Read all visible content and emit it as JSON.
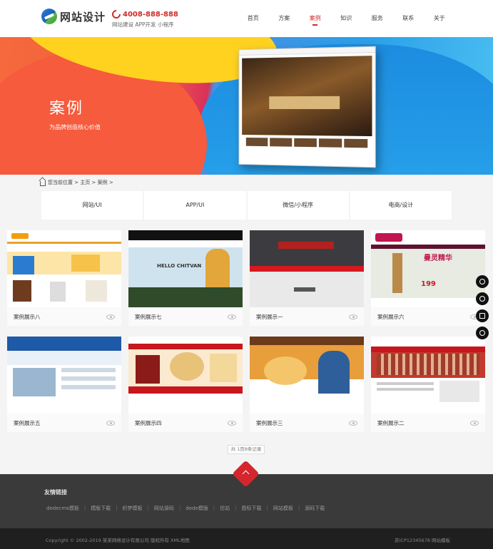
{
  "header": {
    "logo_text": "网站设计",
    "phone": "4008-888-888",
    "phone_sub": "网站建设 APP开发 小程序",
    "nav": [
      "首页",
      "方案",
      "案例",
      "知识",
      "服务",
      "联系",
      "关于"
    ],
    "active_nav": "案例"
  },
  "banner": {
    "title": "案例",
    "subtitle": "为品牌创造核心价值"
  },
  "breadcrumb": {
    "text": "您当前位置 > 主页 > 案例 >"
  },
  "tabs": [
    "网站/UI",
    "APP/UI",
    "微信/小程序",
    "电商/设计"
  ],
  "cases": [
    {
      "title": "案例展示八"
    },
    {
      "title": "案例展示七"
    },
    {
      "title": "案例展示一"
    },
    {
      "title": "案例展示六"
    },
    {
      "title": "案例展示五"
    },
    {
      "title": "案例展示四"
    },
    {
      "title": "案例展示三"
    },
    {
      "title": "案例展示二"
    }
  ],
  "thumbs": {
    "c2_text": "HELLO CHITVAN",
    "c4_text": "曼灵精华",
    "c4_price": "199"
  },
  "pagination": "共 1页8条记录",
  "footer": {
    "links_title": "友情链接",
    "links": [
      "dedecms模板",
      "模版下载",
      "织梦模板",
      "网站源码",
      "dede模版",
      "仿站",
      "图标下载",
      "网站模板",
      "源码下载"
    ],
    "copyright": "Copyright © 2002-2019 某某网络设计有限公司 版权所有   XML地图",
    "icp": "苏ICP12345678    网站模板"
  },
  "side_float_icons": [
    "qq-icon",
    "user-icon",
    "note-icon",
    "phone-icon"
  ],
  "colors": {
    "accent": "#d12a2a",
    "footer_bg": "#3a3a3a",
    "footer_bottom_bg": "#1f1f1f"
  }
}
